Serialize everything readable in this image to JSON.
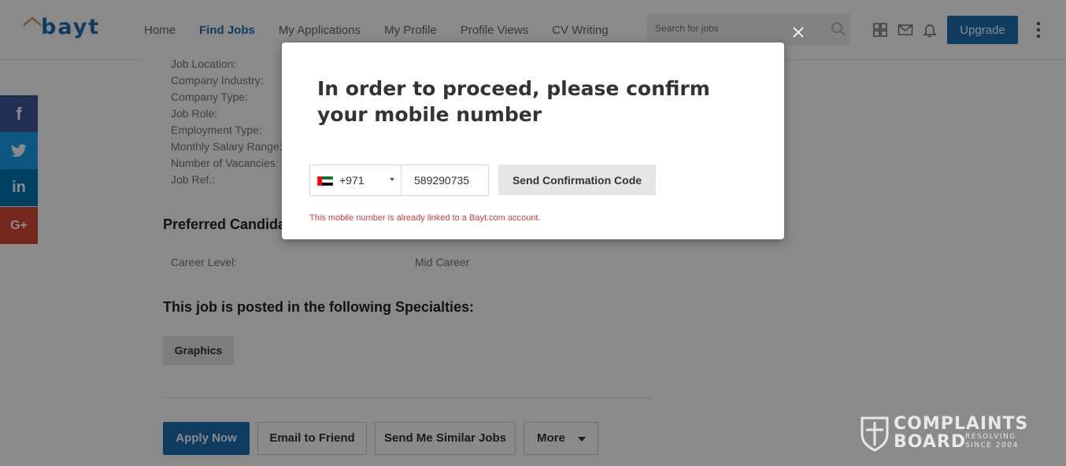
{
  "header": {
    "logo_text": "bayt",
    "nav": [
      "Home",
      "Find Jobs",
      "My Applications",
      "My Profile",
      "Profile Views",
      "CV Writing"
    ],
    "active_nav": "Find Jobs",
    "search_placeholder": "Search for jobs",
    "upgrade_label": "Upgrade",
    "icons": [
      "apps-grid-icon",
      "mail-icon",
      "bell-icon",
      "more-vertical-icon"
    ]
  },
  "job_details": {
    "labels": [
      "Job Location:",
      "Company Industry:",
      "Company Type:",
      "Job Role:",
      "Employment Type:",
      "Monthly Salary Range:",
      "Number of Vacancies:",
      "Job Ref.:"
    ],
    "preferred_title": "Preferred Candidate",
    "career_level_label": "Career Level:",
    "career_level_value": "Mid Career",
    "specialties_title": "This job is posted in the following Specialties:",
    "specialty_tag": "Graphics"
  },
  "actions": {
    "apply": "Apply Now",
    "email": "Email to Friend",
    "similar": "Send Me Similar Jobs",
    "more": "More"
  },
  "social": [
    {
      "name": "facebook",
      "glyph": "f",
      "color": "#3b5998"
    },
    {
      "name": "twitter",
      "glyph": "t",
      "color": "#1da1f2"
    },
    {
      "name": "linkedin",
      "glyph": "in",
      "color": "#0077b5"
    },
    {
      "name": "googleplus",
      "glyph": "G+",
      "color": "#dd4b39"
    }
  ],
  "modal": {
    "title": "In order to proceed, please confirm your mobile number",
    "country_code": "+971",
    "phone_number": "589290735",
    "send_label": "Send Confirmation Code",
    "error": "This mobile number is already linked to a Bayt.com account."
  },
  "watermark": {
    "line1": "COMPLAINTS",
    "line2": "BOARD",
    "small1": "RESOLVING",
    "small2": "SINCE 2004"
  },
  "colors": {
    "brand": "#1f6fb5",
    "error": "#d23b3b",
    "overlay": "rgba(0,0,0,0.46)"
  }
}
